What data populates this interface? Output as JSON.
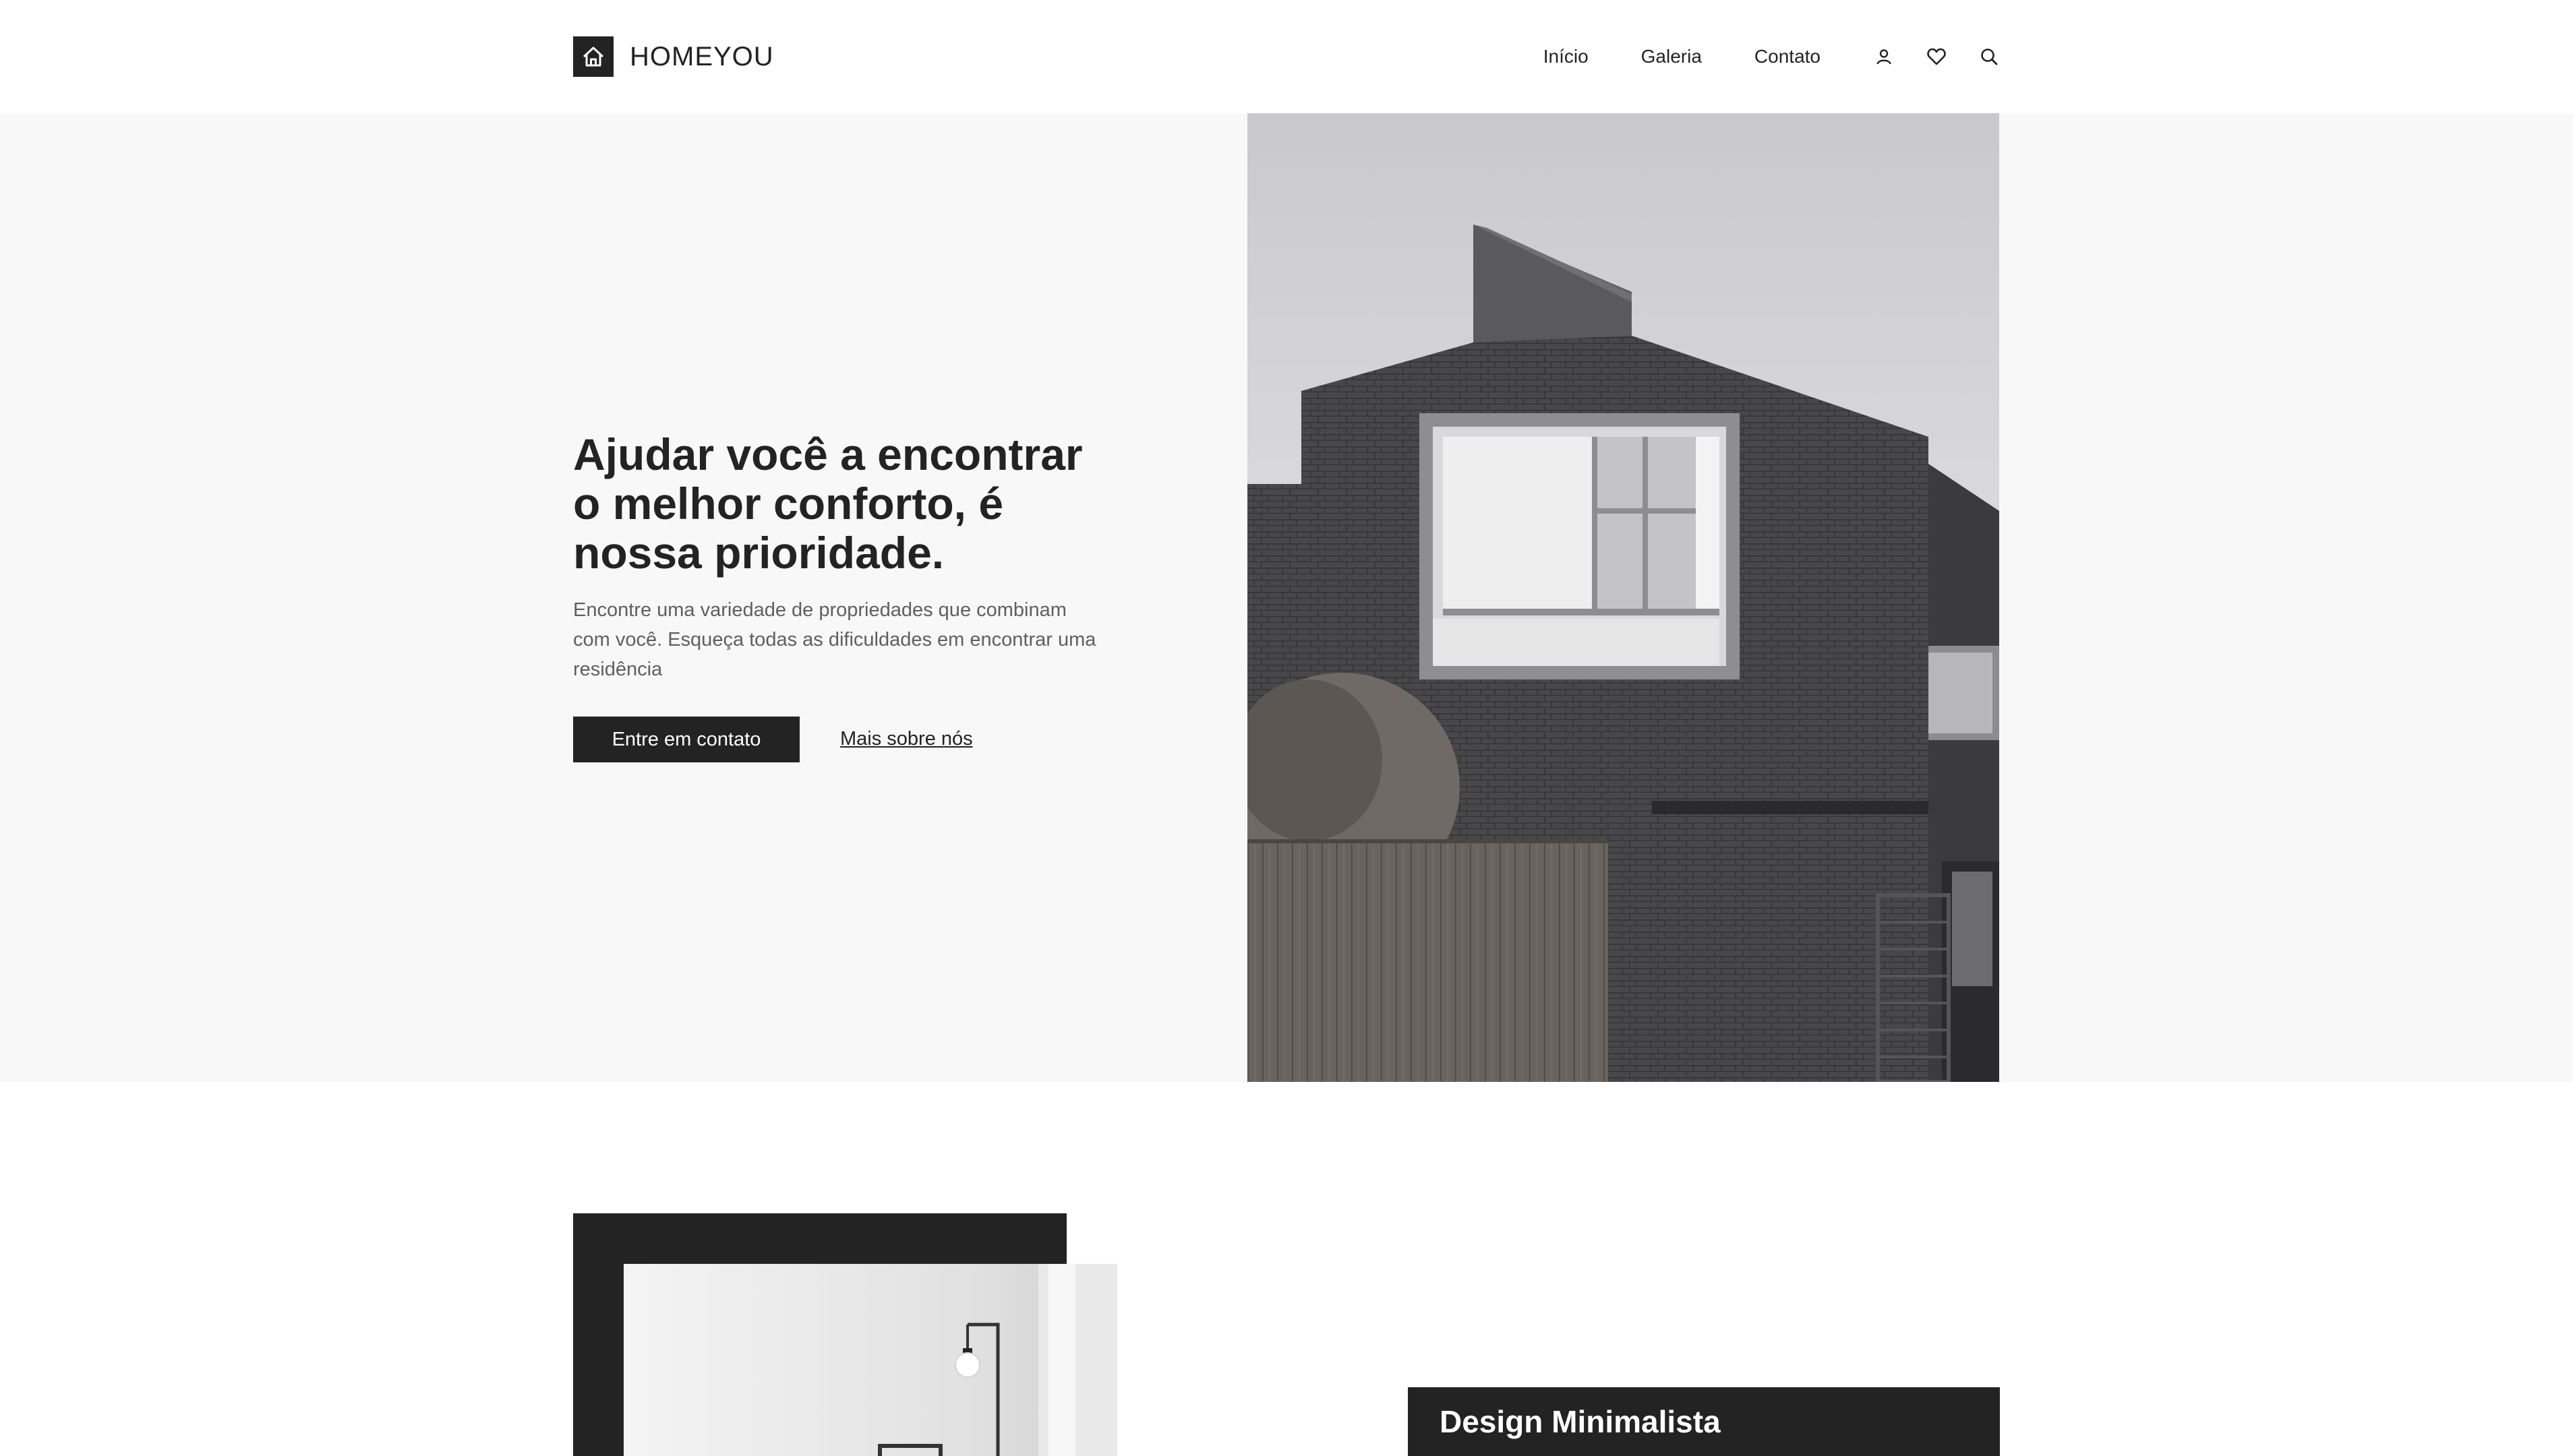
{
  "header": {
    "logo_text": "HOMEYOU",
    "logo_icon": "house-icon",
    "nav": [
      {
        "label": "Início"
      },
      {
        "label": "Galeria"
      },
      {
        "label": "Contato"
      }
    ],
    "icons": [
      "user-icon",
      "heart-icon",
      "search-icon"
    ]
  },
  "hero": {
    "title": "Ajudar você a encontrar o melhor conforto, é nossa prioridade.",
    "description": "Encontre uma variedade de propriedades que combinam com você. Esqueça todas as dificuldades em encontrar uma residência",
    "primary_button": "Entre em contato",
    "secondary_link": "Mais sobre nós",
    "image": "modern-dark-brick-house-photo"
  },
  "section_feature": {
    "image": "minimalist-interior-photo",
    "card_title": "Design Minimalista"
  },
  "colors": {
    "dark": "#232323",
    "hero_bg": "#f8f8f8",
    "text_muted": "#5f5f5f",
    "white": "#ffffff"
  }
}
